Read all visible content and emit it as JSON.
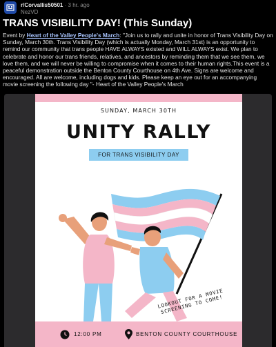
{
  "post": {
    "subreddit": "r/Corvallis50501",
    "separator": "·",
    "time_ago": "3 hr. ago",
    "author": "NezVD",
    "title": "TRANS VISIBILITY DAY! (This Sunday)",
    "body_prefix": "Event by ",
    "body_link": "Heart of the Valley People's March",
    "body_text": ": \"Join us to rally and unite in honor of Trans Visibility Day on Sunday, March 30th. Trans Visibility Day (which is actually Monday, March 31st) is an opportunity to remind our community that trans people HAVE ALWAYS existed and WILL ALWAYS exist. We plan to celebrate and honor our trans friends, relatives, and ancestors by reminding them that we see them, we love them, and we will never be willing to compromise when it comes to their human rights.This event is a peaceful demonstration outside the Benton County Courthouse on 4th Ave. Signs are welcome and encouraged. All are welcome, including dogs and kids. Please keep an eye out for an accompanying movie screening the following day \"- Heart of the Valley People's March"
  },
  "poster": {
    "date": "SUNDAY, MARCH 30TH",
    "title": "UNITY RALLY",
    "ribbon": "FOR TRANS VISIBILITY DAY",
    "note_line1": "LOOKOUT FOR A MOVIE",
    "note_line2": "SCREENING TO COME!",
    "time": "12:00 PM",
    "location": "BENTON COUNTY COURTHOUSE"
  },
  "colors": {
    "background": "#000000",
    "trans_pink": "#f4b6c8",
    "trans_blue": "#8dcdf0",
    "link": "#a9c5ff",
    "subreddit_icon": "#1f4aa8"
  },
  "icons": {
    "subreddit": "subreddit-icon",
    "clock": "clock-icon",
    "location": "map-pin-icon"
  }
}
